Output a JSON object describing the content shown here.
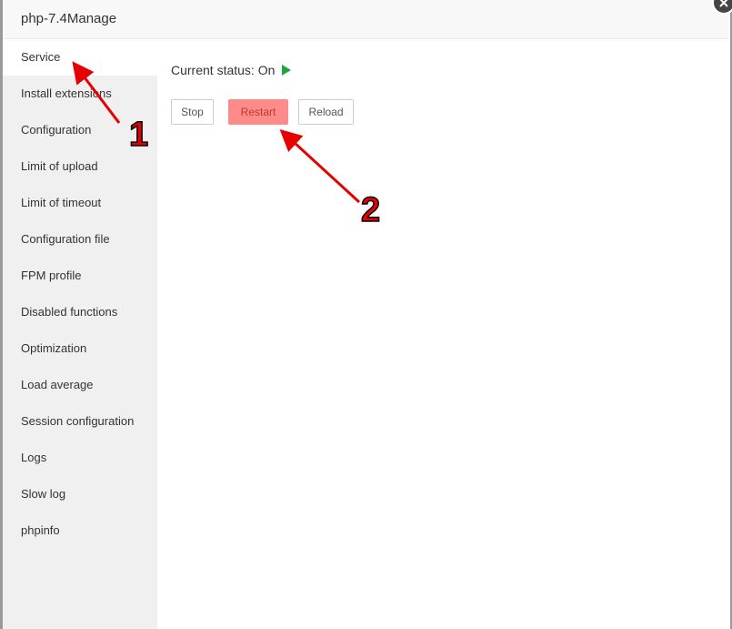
{
  "window": {
    "title": "php-7.4Manage"
  },
  "sidebar": {
    "items": [
      {
        "label": "Service"
      },
      {
        "label": "Install extensions"
      },
      {
        "label": "Configuration"
      },
      {
        "label": "Limit of upload"
      },
      {
        "label": "Limit of timeout"
      },
      {
        "label": "Configuration file"
      },
      {
        "label": "FPM profile"
      },
      {
        "label": "Disabled functions"
      },
      {
        "label": "Optimization"
      },
      {
        "label": "Load average"
      },
      {
        "label": "Session configuration"
      },
      {
        "label": "Logs"
      },
      {
        "label": "Slow log"
      },
      {
        "label": "phpinfo"
      }
    ]
  },
  "service": {
    "status_label": "Current status:",
    "status_value": "On",
    "stop_label": "Stop",
    "restart_label": "Restart",
    "reload_label": "Reload"
  },
  "annotations": {
    "marker_1": "1",
    "marker_2": "2",
    "color": "#e60000"
  },
  "colors": {
    "on_indicator": "#20a53a",
    "restart_highlight": "#ff8a8a"
  }
}
